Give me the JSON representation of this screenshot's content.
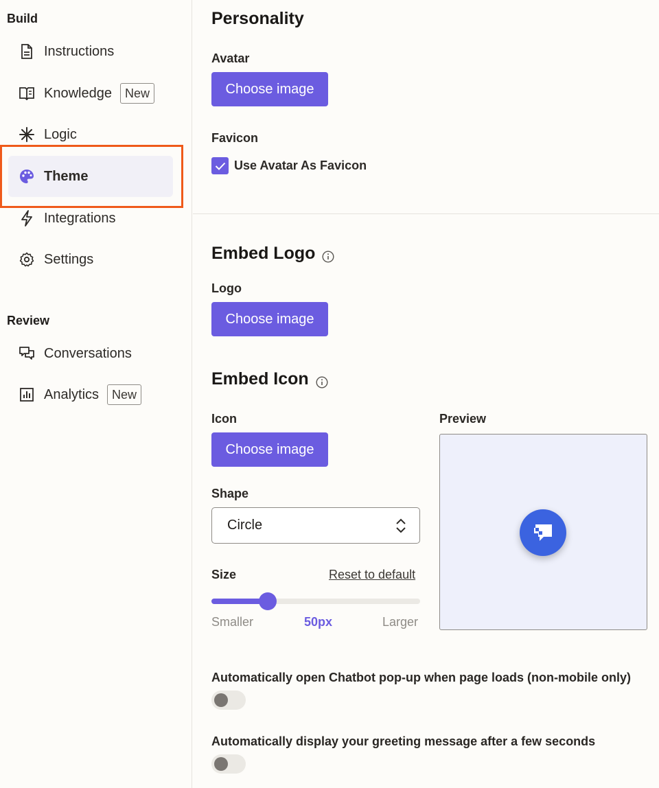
{
  "sidebar": {
    "build_title": "Build",
    "review_title": "Review",
    "build_items": [
      {
        "label": "Instructions",
        "icon": "document-icon"
      },
      {
        "label": "Knowledge",
        "icon": "book-icon",
        "badge": "New"
      },
      {
        "label": "Logic",
        "icon": "asterisk-icon"
      },
      {
        "label": "Theme",
        "icon": "palette-icon",
        "active": true
      },
      {
        "label": "Integrations",
        "icon": "lightning-icon"
      },
      {
        "label": "Settings",
        "icon": "gear-icon"
      }
    ],
    "review_items": [
      {
        "label": "Conversations",
        "icon": "chat-bubbles-icon"
      },
      {
        "label": "Analytics",
        "icon": "bar-chart-icon",
        "badge": "New"
      }
    ]
  },
  "personality": {
    "title": "Personality",
    "avatar_label": "Avatar",
    "avatar_button": "Choose image",
    "favicon_label": "Favicon",
    "favicon_checkbox": "Use Avatar As Favicon",
    "favicon_checked": true
  },
  "embed_logo": {
    "title": "Embed Logo",
    "logo_label": "Logo",
    "logo_button": "Choose image"
  },
  "embed_icon": {
    "title": "Embed Icon",
    "icon_label": "Icon",
    "icon_button": "Choose image",
    "preview_label": "Preview",
    "shape_label": "Shape",
    "shape_value": "Circle",
    "size_label": "Size",
    "reset_link": "Reset to default",
    "size_min_label": "Smaller",
    "size_value": "50px",
    "size_max_label": "Larger",
    "size_fraction": 0.27
  },
  "toggles": [
    {
      "label": "Automatically open Chatbot pop-up when page loads (non-mobile only)",
      "on": false
    },
    {
      "label": "Automatically display your greeting message after a few seconds",
      "on": false
    }
  ],
  "colors": {
    "accent": "#6b5ce0",
    "highlight": "#ef5a1a",
    "preview_icon": "#3b63e0"
  }
}
